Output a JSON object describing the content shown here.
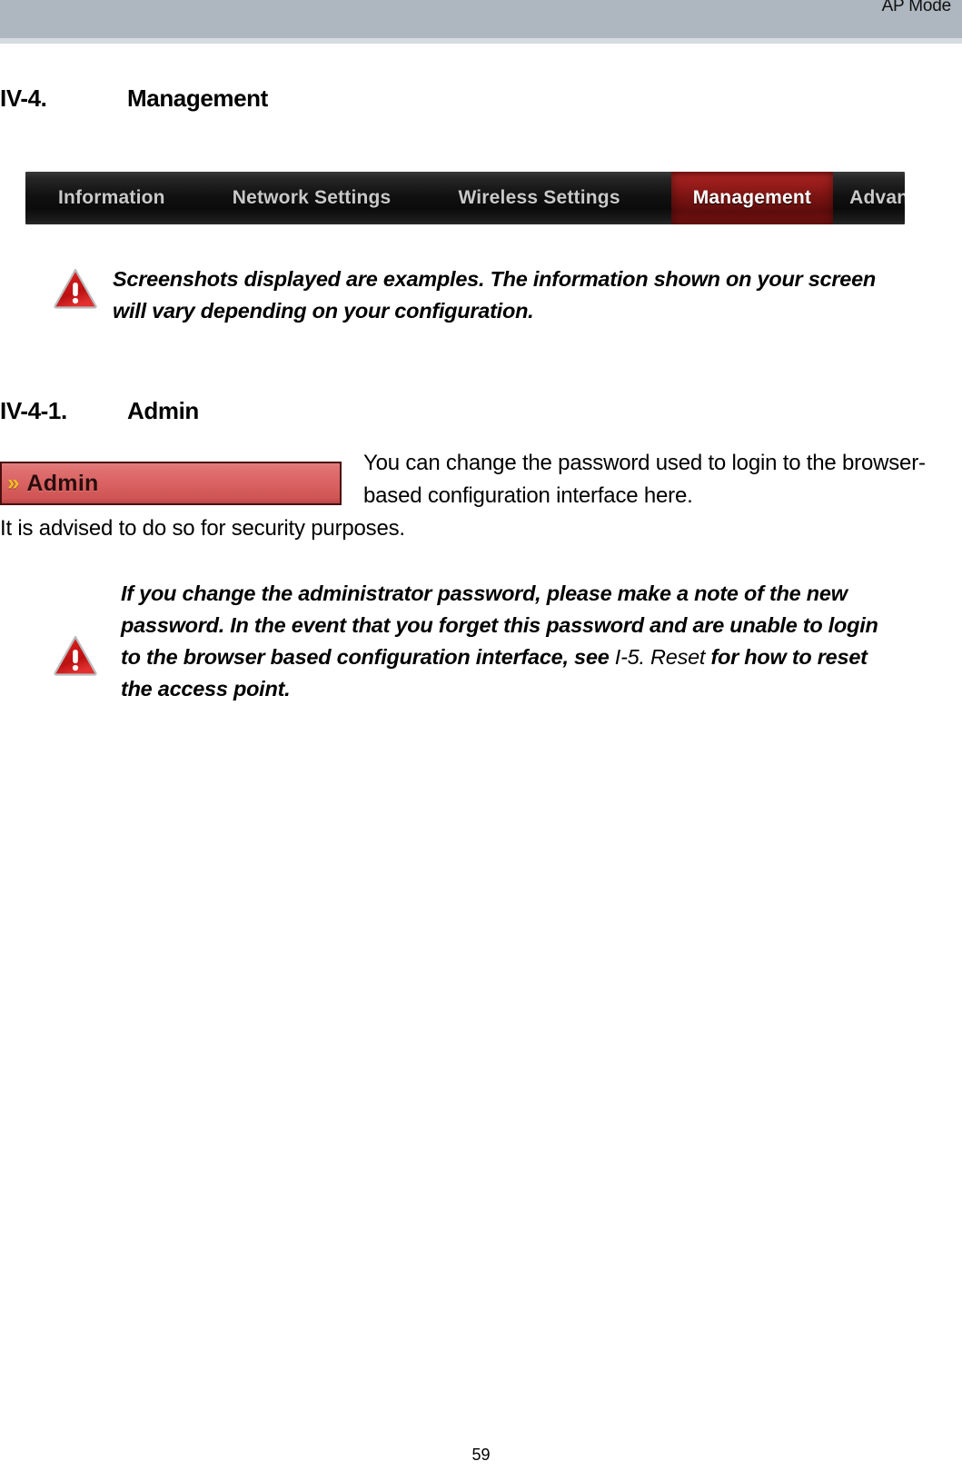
{
  "header": {
    "mode_label": "AP Mode"
  },
  "headings": {
    "management": {
      "number": "IV-4.",
      "title": "Management"
    },
    "admin": {
      "number": "IV-4-1.",
      "title": "Admin"
    }
  },
  "nav": {
    "tabs": [
      {
        "label": "Information",
        "active": false
      },
      {
        "label": "Network Settings",
        "active": false
      },
      {
        "label": "Wireless Settings",
        "active": false
      },
      {
        "label": "Management",
        "active": true
      },
      {
        "label": "Advanced",
        "active": false
      }
    ]
  },
  "notes": {
    "screenshots": {
      "icon": "warning-triangle-icon",
      "text": "Screenshots displayed are examples. The information shown on your screen will vary depending on your configuration."
    },
    "password": {
      "icon": "warning-triangle-icon",
      "text_before": "If you change the administrator password, please make a note of the new password. In the event that you forget this password and are unable to login to the browser based configuration interface, see ",
      "cross_reference": "I-5. Reset",
      "text_after": " for how to reset the access point."
    }
  },
  "admin_button": {
    "chevron": "»",
    "label": "Admin"
  },
  "body": {
    "paragraph_right": "You can change the password used to login to the browser-based configuration interface here.",
    "paragraph_left": "It is advised to do so for security purposes."
  },
  "footer": {
    "page_number": "59"
  },
  "colors": {
    "header_band": "#aeb6bf",
    "header_underline": "#d6dbe0",
    "nav_background": "#111111",
    "nav_active": "#8d1a18",
    "nav_text": "#c9c9c9",
    "admin_button_fill": "#d96060",
    "admin_button_border": "#4a0f0f",
    "admin_chevron": "#f0c020",
    "warning_red": "#cc1f1f"
  }
}
